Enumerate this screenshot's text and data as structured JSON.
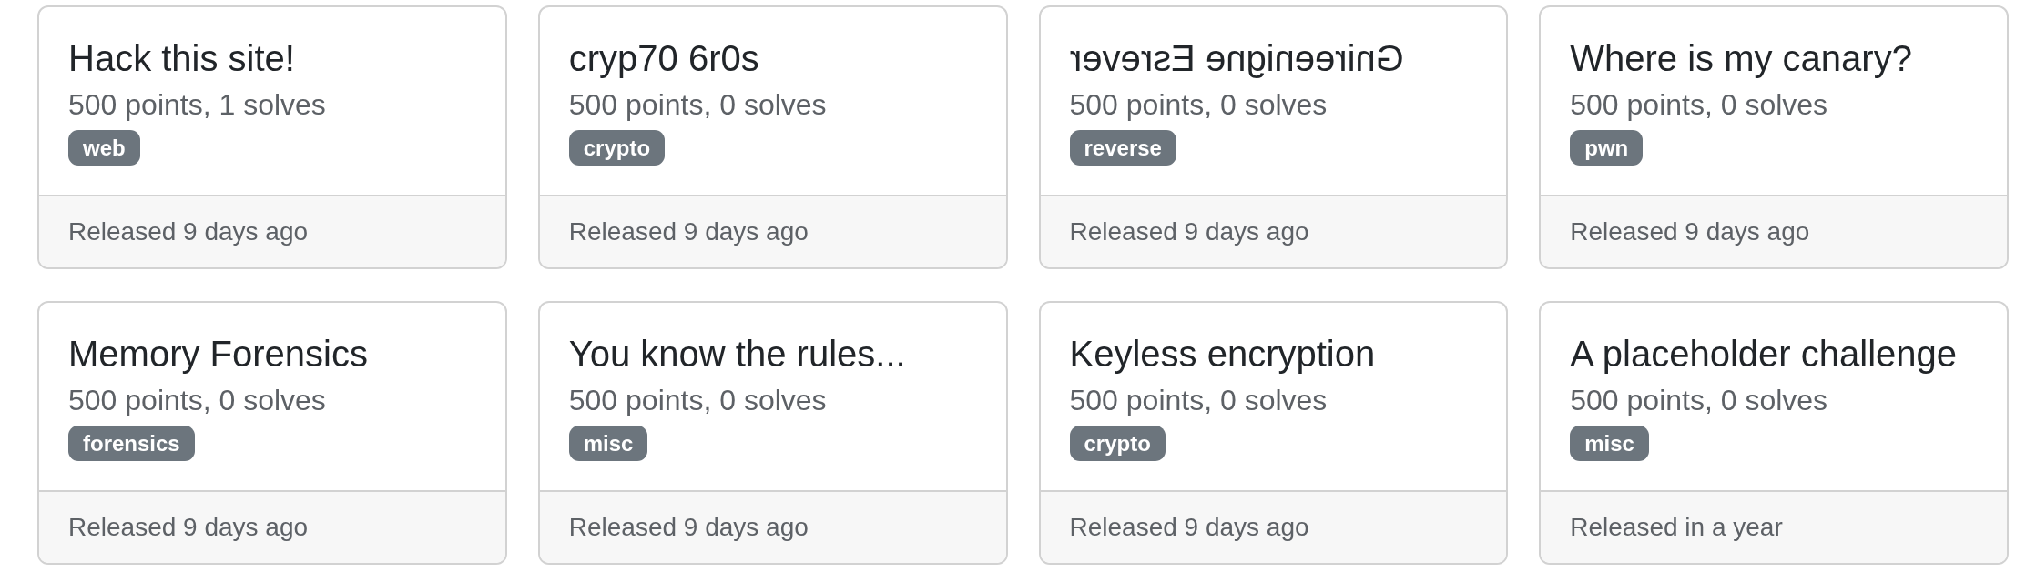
{
  "challenges": [
    {
      "title": "Hack this site!",
      "mirrored": false,
      "stats": "500 points, 1 solves",
      "tags": [
        "web"
      ],
      "released": "Released 9 days ago"
    },
    {
      "title": "cryp70 6r0s",
      "mirrored": false,
      "stats": "500 points, 0 solves",
      "tags": [
        "crypto"
      ],
      "released": "Released 9 days ago"
    },
    {
      "title": "Gnireenigne Esrever",
      "mirrored": true,
      "stats": "500 points, 0 solves",
      "tags": [
        "reverse"
      ],
      "released": "Released 9 days ago"
    },
    {
      "title": "Where is my canary?",
      "mirrored": false,
      "stats": "500 points, 0 solves",
      "tags": [
        "pwn"
      ],
      "released": "Released 9 days ago"
    },
    {
      "title": "Memory Forensics",
      "mirrored": false,
      "stats": "500 points, 0 solves",
      "tags": [
        "forensics"
      ],
      "released": "Released 9 days ago"
    },
    {
      "title": "You know the rules...",
      "mirrored": false,
      "stats": "500 points, 0 solves",
      "tags": [
        "misc"
      ],
      "released": "Released 9 days ago"
    },
    {
      "title": "Keyless encryption",
      "mirrored": false,
      "stats": "500 points, 0 solves",
      "tags": [
        "crypto"
      ],
      "released": "Released 9 days ago"
    },
    {
      "title": "A placeholder challenge",
      "mirrored": false,
      "stats": "500 points, 0 solves",
      "tags": [
        "misc"
      ],
      "released": "Released in a year"
    }
  ]
}
